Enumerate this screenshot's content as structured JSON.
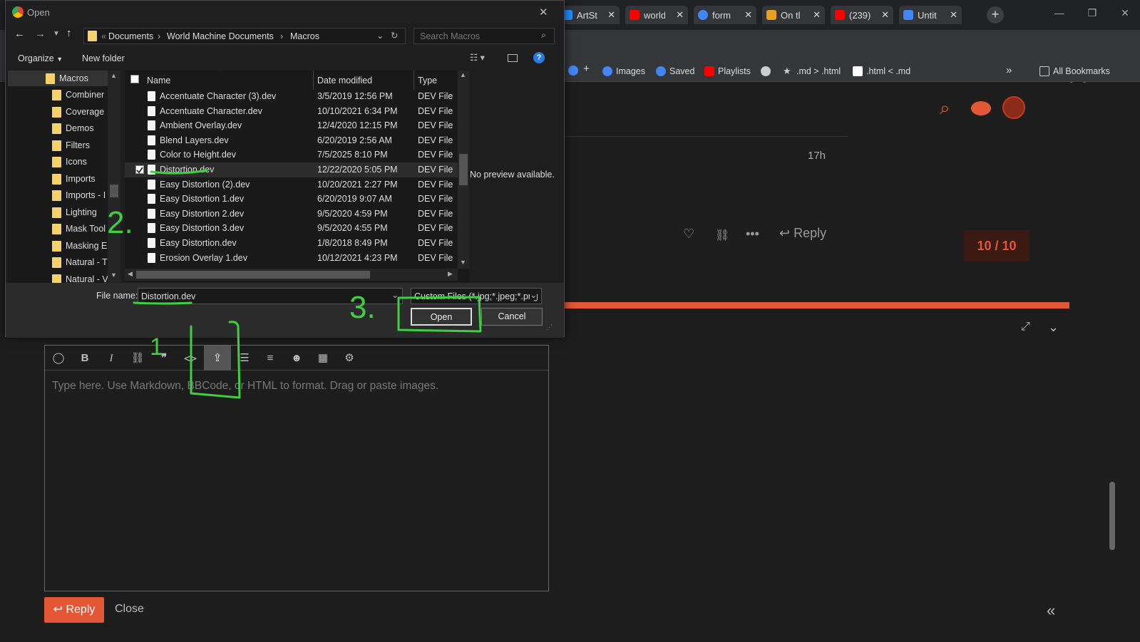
{
  "browser": {
    "tabs": [
      {
        "label": "ArtSt",
        "color": "#1e90ff"
      },
      {
        "label": "world",
        "color": "#ff0000"
      },
      {
        "label": "form",
        "color": "#4285f4"
      },
      {
        "label": "On tl",
        "color": "#e8a020"
      },
      {
        "label": "(239)",
        "color": "#ff0000"
      },
      {
        "label": "Untit",
        "color": "#4285f4"
      }
    ],
    "new_tab": "+",
    "bookmarks": [
      {
        "label": "Images",
        "color": "#4285f4"
      },
      {
        "label": "Saved",
        "color": "#4285f4"
      },
      {
        "label": "Playlists",
        "color": "#ff0000"
      },
      {
        "label": ".md > .html",
        "color": "#cccccc"
      },
      {
        "label": ".html < .md",
        "color": "#ffffff"
      }
    ],
    "bookmarks_overflow": "»",
    "all_bookmarks": "All Bookmarks"
  },
  "dialog": {
    "title": "Open",
    "path": [
      "Documents",
      "World Machine Documents",
      "Macros"
    ],
    "search_placeholder": "Search Macros",
    "organize": "Organize",
    "new_folder": "New folder",
    "nav": [
      "Macros",
      "Combiner",
      "Coverage",
      "Demos",
      "Filters",
      "Icons",
      "Imports",
      "Imports - I",
      "Lighting",
      "Mask Tool",
      "Masking E",
      "Natural - T",
      "Natural - V"
    ],
    "columns": {
      "name": "Name",
      "date": "Date modified",
      "type": "Type"
    },
    "files": [
      {
        "name": "Accentuate Character (3).dev",
        "date": "3/5/2019 12:56 PM",
        "type": "DEV File"
      },
      {
        "name": "Accentuate Character.dev",
        "date": "10/10/2021 6:34 PM",
        "type": "DEV File"
      },
      {
        "name": "Ambient  Overlay.dev",
        "date": "12/4/2020 12:15 PM",
        "type": "DEV File"
      },
      {
        "name": "Blend Layers.dev",
        "date": "6/20/2019 2:56 AM",
        "type": "DEV File"
      },
      {
        "name": "Color to Height.dev",
        "date": "7/5/2025 8:10 PM",
        "type": "DEV File"
      },
      {
        "name": "Distortion.dev",
        "date": "12/22/2020 5:05 PM",
        "type": "DEV File"
      },
      {
        "name": "Easy Distortion (2).dev",
        "date": "10/20/2021 2:27 PM",
        "type": "DEV File"
      },
      {
        "name": "Easy Distortion 1.dev",
        "date": "6/20/2019 9:07 AM",
        "type": "DEV File"
      },
      {
        "name": "Easy Distortion 2.dev",
        "date": "9/5/2020 4:59 PM",
        "type": "DEV File"
      },
      {
        "name": "Easy Distortion 3.dev",
        "date": "9/5/2020 4:55 PM",
        "type": "DEV File"
      },
      {
        "name": "Easy Distortion.dev",
        "date": "1/8/2018 8:49 PM",
        "type": "DEV File"
      },
      {
        "name": "Erosion Overlay 1.dev",
        "date": "10/12/2021 4:23 PM",
        "type": "DEV File"
      }
    ],
    "preview": "No preview available.",
    "filename_label": "File name:",
    "filename_value": "Distortion.dev",
    "filetype_value": "Custom Files (*.jpg;*.jpeg;*.png",
    "open": "Open",
    "cancel": "Cancel"
  },
  "forum": {
    "time_ago": "17h",
    "reply": "Reply",
    "progress": "10 / 10",
    "editor_placeholder": "Type here. Use Markdown, BBCode, or HTML to format. Drag or paste images.",
    "reply_button": "Reply",
    "close_button": "Close"
  },
  "annotations": {
    "step1": "1",
    "step2": "2.",
    "step3": "3."
  },
  "colors": {
    "accent": "#e45735",
    "annotation": "#3fd03f"
  }
}
